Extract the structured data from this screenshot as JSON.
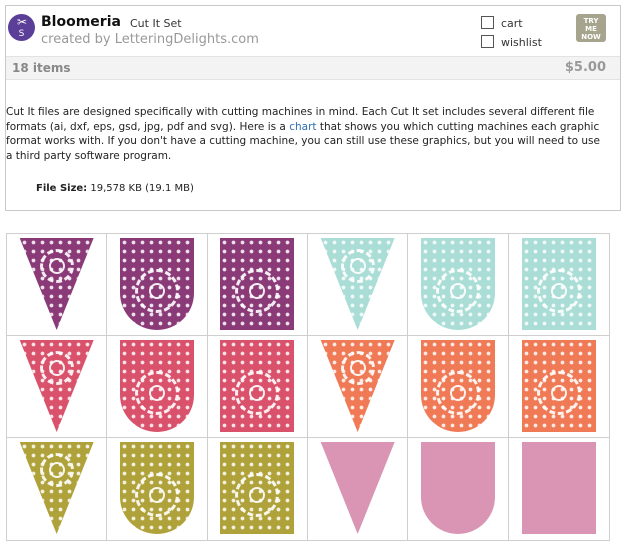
{
  "header": {
    "logo_top": "✂",
    "logo_bottom": "S",
    "title": "Bloomeria",
    "subtitle": "Cut It Set",
    "creator": "created by LetteringDelights.com",
    "cart_label": "cart",
    "wishlist_label": "wishlist",
    "try_lines": [
      "TRY",
      "ME",
      "NOW"
    ]
  },
  "meta": {
    "items_count": "18 items",
    "price": "$5.00"
  },
  "description": {
    "part1": "Cut It files are designed specifically with cutting machines in mind. Each Cut It set includes several different file formats (ai, dxf, eps, gsd, jpg, pdf and svg). Here is a ",
    "link_text": "chart",
    "part2": " that shows you which cutting machines each graphic format works with. If you don't have a cutting machine, you can still use these graphics, but you will need to use a third party software program."
  },
  "filesize": {
    "label": "File Size:",
    "value": "19,578 KB (19.1 MB)"
  },
  "banners": [
    {
      "shape": "tri",
      "color": "#8b3a78",
      "pattern": true
    },
    {
      "shape": "arch",
      "color": "#8b3a78",
      "pattern": true
    },
    {
      "shape": "rect",
      "color": "#8b3a78",
      "pattern": true
    },
    {
      "shape": "tri",
      "color": "#a9ddd6",
      "pattern": true
    },
    {
      "shape": "arch",
      "color": "#a9ddd6",
      "pattern": true
    },
    {
      "shape": "rect",
      "color": "#a9ddd6",
      "pattern": true
    },
    {
      "shape": "tri",
      "color": "#d9516a",
      "pattern": true
    },
    {
      "shape": "arch",
      "color": "#d9516a",
      "pattern": true
    },
    {
      "shape": "rect",
      "color": "#d9516a",
      "pattern": true
    },
    {
      "shape": "tri",
      "color": "#ef7a55",
      "pattern": true
    },
    {
      "shape": "arch",
      "color": "#ef7a55",
      "pattern": true
    },
    {
      "shape": "rect",
      "color": "#ef7a55",
      "pattern": true
    },
    {
      "shape": "tri",
      "color": "#b0a23a",
      "pattern": true
    },
    {
      "shape": "arch",
      "color": "#b0a23a",
      "pattern": true
    },
    {
      "shape": "rect",
      "color": "#b0a23a",
      "pattern": true
    },
    {
      "shape": "tri",
      "color": "#d995b3",
      "pattern": false
    },
    {
      "shape": "arch",
      "color": "#d995b3",
      "pattern": false
    },
    {
      "shape": "rect",
      "color": "#d995b3",
      "pattern": false
    }
  ]
}
